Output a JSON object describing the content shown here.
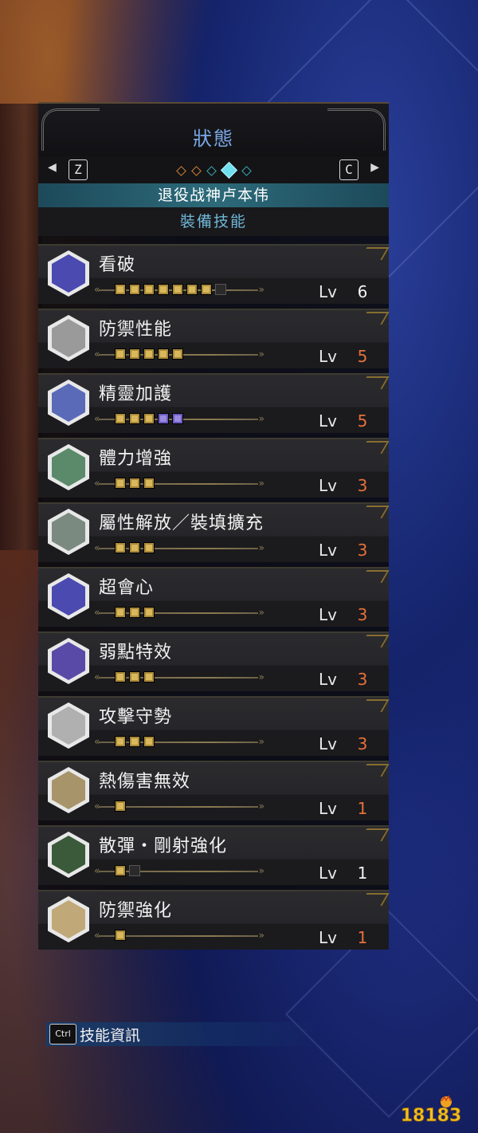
{
  "header": {
    "title": "狀態",
    "left_key": "Z",
    "right_key": "C",
    "left_arrow": "◀",
    "right_arrow": "▶"
  },
  "character": {
    "name": "退役战神卢本伟"
  },
  "section": {
    "title": "裝備技能"
  },
  "skills": [
    {
      "name": "看破",
      "lv_label": "Lv",
      "level": "6",
      "level_color": "white",
      "badge_color": "#4a4ab0",
      "pips": [
        "gold",
        "gold",
        "gold",
        "gold",
        "gold",
        "gold",
        "gold",
        "empty"
      ]
    },
    {
      "name": "防禦性能",
      "lv_label": "Lv",
      "level": "5",
      "level_color": "orange",
      "badge_color": "#9a9a9a",
      "pips": [
        "gold",
        "gold",
        "gold",
        "gold",
        "gold"
      ]
    },
    {
      "name": "精靈加護",
      "lv_label": "Lv",
      "level": "5",
      "level_color": "orange",
      "badge_color": "#5a6ab8",
      "pips": [
        "gold",
        "gold",
        "gold",
        "purple",
        "purple"
      ]
    },
    {
      "name": "體力增強",
      "lv_label": "Lv",
      "level": "3",
      "level_color": "orange",
      "badge_color": "#5a8a6a",
      "pips": [
        "gold",
        "gold",
        "gold"
      ]
    },
    {
      "name": "屬性解放／裝填擴充",
      "lv_label": "Lv",
      "level": "3",
      "level_color": "orange",
      "badge_color": "#7a8a80",
      "pips": [
        "gold",
        "gold",
        "gold"
      ]
    },
    {
      "name": "超會心",
      "lv_label": "Lv",
      "level": "3",
      "level_color": "orange",
      "badge_color": "#4a4ab0",
      "pips": [
        "gold",
        "gold",
        "gold"
      ]
    },
    {
      "name": "弱點特效",
      "lv_label": "Lv",
      "level": "3",
      "level_color": "orange",
      "badge_color": "#5a4aa8",
      "pips": [
        "gold",
        "gold",
        "gold"
      ]
    },
    {
      "name": "攻擊守勢",
      "lv_label": "Lv",
      "level": "3",
      "level_color": "orange",
      "badge_color": "#b0b0b0",
      "pips": [
        "gold",
        "gold",
        "gold"
      ]
    },
    {
      "name": "熱傷害無效",
      "lv_label": "Lv",
      "level": "1",
      "level_color": "orange",
      "badge_color": "#a8946a",
      "pips": [
        "gold"
      ]
    },
    {
      "name": "散彈・剛射強化",
      "lv_label": "Lv",
      "level": "1",
      "level_color": "white",
      "badge_color": "#3a5a3a",
      "pips": [
        "gold",
        "empty"
      ]
    },
    {
      "name": "防禦強化",
      "lv_label": "Lv",
      "level": "1",
      "level_color": "orange",
      "badge_color": "#c0a878",
      "pips": [
        "gold"
      ]
    }
  ],
  "footer": {
    "key": "Ctrl",
    "label": "技能資訊"
  },
  "watermark": {
    "text": "18183"
  },
  "colors": {
    "title": "#7aa8e8",
    "section": "#6fb6d6",
    "gold_pip": "#d8b85a",
    "purple_pip": "#9a8ae0",
    "level_orange": "#e8703a"
  }
}
